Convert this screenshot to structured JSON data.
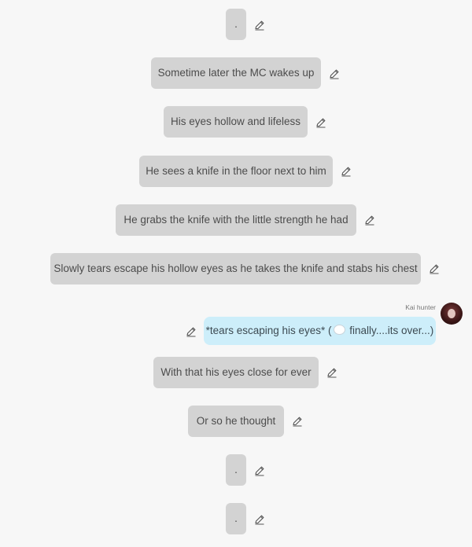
{
  "messages": [
    {
      "text": "."
    },
    {
      "text": "Sometime later the MC wakes up"
    },
    {
      "text": "His eyes hollow and lifeless"
    },
    {
      "text": "He sees a knife in the floor next to him"
    },
    {
      "text": "He grabs the knife with the little strength he had"
    },
    {
      "text": "Slowly tears escape his hollow eyes as he takes the knife and stabs his chest"
    },
    {
      "text": "With that his eyes close for ever"
    },
    {
      "text": "Or so he thought"
    },
    {
      "text": "."
    },
    {
      "text": "."
    }
  ],
  "user_message": {
    "sender": "Kai hunter",
    "text_before": "*tears escaping his eyes* (",
    "emoji": "thought-bubble-emoji",
    "text_after": " finally....its over...)"
  },
  "icons": {
    "edit": "pencil-icon",
    "avatar": "user-avatar"
  },
  "colors": {
    "background": "#f7f7f7",
    "bot_bubble": "#d3d3d3",
    "user_bubble": "#cdeefa"
  }
}
